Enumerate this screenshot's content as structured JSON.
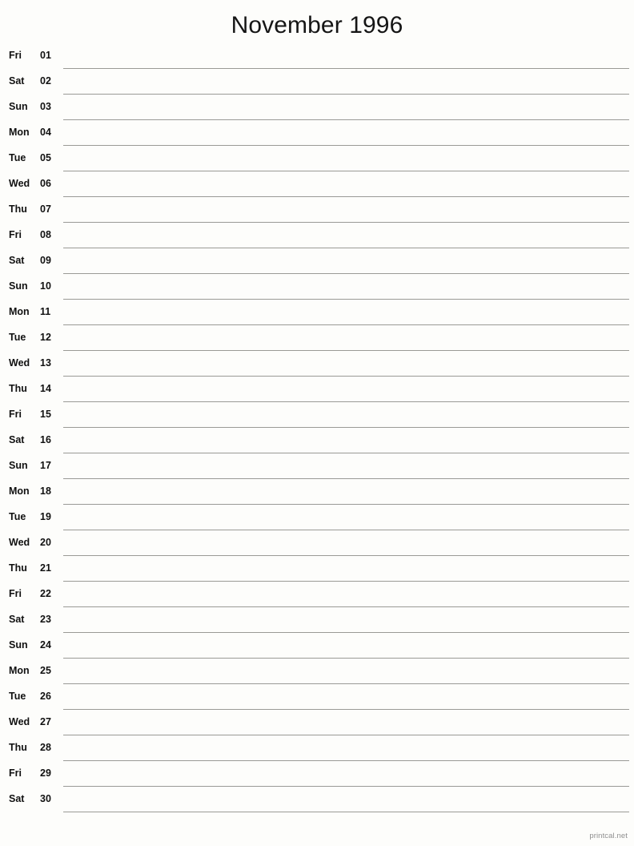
{
  "page": {
    "title": "November 1996",
    "background_color": "#fdfdfb",
    "text_color": "#111111",
    "rule_color": "#9a9a96"
  },
  "footer": {
    "attribution": "printcal.net",
    "color": "#8f8f8f"
  },
  "calendar": {
    "month_name": "November",
    "year": "1996",
    "days_in_month": 30,
    "rows": [
      {
        "weekday": "Fri",
        "day": "01"
      },
      {
        "weekday": "Sat",
        "day": "02"
      },
      {
        "weekday": "Sun",
        "day": "03"
      },
      {
        "weekday": "Mon",
        "day": "04"
      },
      {
        "weekday": "Tue",
        "day": "05"
      },
      {
        "weekday": "Wed",
        "day": "06"
      },
      {
        "weekday": "Thu",
        "day": "07"
      },
      {
        "weekday": "Fri",
        "day": "08"
      },
      {
        "weekday": "Sat",
        "day": "09"
      },
      {
        "weekday": "Sun",
        "day": "10"
      },
      {
        "weekday": "Mon",
        "day": "11"
      },
      {
        "weekday": "Tue",
        "day": "12"
      },
      {
        "weekday": "Wed",
        "day": "13"
      },
      {
        "weekday": "Thu",
        "day": "14"
      },
      {
        "weekday": "Fri",
        "day": "15"
      },
      {
        "weekday": "Sat",
        "day": "16"
      },
      {
        "weekday": "Sun",
        "day": "17"
      },
      {
        "weekday": "Mon",
        "day": "18"
      },
      {
        "weekday": "Tue",
        "day": "19"
      },
      {
        "weekday": "Wed",
        "day": "20"
      },
      {
        "weekday": "Thu",
        "day": "21"
      },
      {
        "weekday": "Fri",
        "day": "22"
      },
      {
        "weekday": "Sat",
        "day": "23"
      },
      {
        "weekday": "Sun",
        "day": "24"
      },
      {
        "weekday": "Mon",
        "day": "25"
      },
      {
        "weekday": "Tue",
        "day": "26"
      },
      {
        "weekday": "Wed",
        "day": "27"
      },
      {
        "weekday": "Thu",
        "day": "28"
      },
      {
        "weekday": "Fri",
        "day": "29"
      },
      {
        "weekday": "Sat",
        "day": "30"
      }
    ]
  }
}
